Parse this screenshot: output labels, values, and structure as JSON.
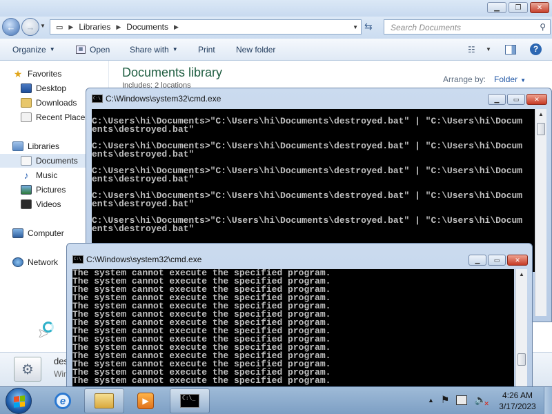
{
  "explorer": {
    "nav": {
      "back": "←",
      "forward": "→"
    },
    "address": {
      "crumbs": [
        "Libraries",
        "Documents"
      ]
    },
    "search": {
      "placeholder": "Search Documents"
    },
    "commands": {
      "organize": "Organize",
      "open": "Open",
      "share": "Share with",
      "print": "Print",
      "new_folder": "New folder"
    },
    "nav_pane": {
      "favorites": "Favorites",
      "desktop": "Desktop",
      "downloads": "Downloads",
      "recent": "Recent Places",
      "libraries": "Libraries",
      "documents": "Documents",
      "music": "Music",
      "pictures": "Pictures",
      "videos": "Videos",
      "computer": "Computer",
      "network": "Network"
    },
    "library": {
      "title": "Documents library",
      "subtitle": "Includes: 2 locations",
      "arrange_label": "Arrange by:",
      "arrange_value": "Folder"
    },
    "details": {
      "name": "des",
      "type": "Win"
    }
  },
  "cmd1": {
    "title": "C:\\Windows\\system32\\cmd.exe",
    "lines": [
      "C:\\Users\\hi\\Documents>\"C:\\Users\\hi\\Documents\\destroyed.bat\" | \"C:\\Users\\hi\\Docum",
      "ents\\destroyed.bat\"",
      "",
      "C:\\Users\\hi\\Documents>\"C:\\Users\\hi\\Documents\\destroyed.bat\" | \"C:\\Users\\hi\\Docum",
      "ents\\destroyed.bat\"",
      "",
      "C:\\Users\\hi\\Documents>\"C:\\Users\\hi\\Documents\\destroyed.bat\" | \"C:\\Users\\hi\\Docum",
      "ents\\destroyed.bat\"",
      "",
      "C:\\Users\\hi\\Documents>\"C:\\Users\\hi\\Documents\\destroyed.bat\" | \"C:\\Users\\hi\\Docum",
      "ents\\destroyed.bat\"",
      "",
      "C:\\Users\\hi\\Documents>\"C:\\Users\\hi\\Documents\\destroyed.bat\" | \"C:\\Users\\hi\\Docum",
      "ents\\destroyed.bat\""
    ]
  },
  "cmd2": {
    "title": "C:\\Windows\\system32\\cmd.exe",
    "line": "The system cannot execute the specified program.",
    "line_count": 14
  },
  "taskbar": {
    "clock_time": "4:26 AM",
    "clock_date": "3/17/2023"
  }
}
